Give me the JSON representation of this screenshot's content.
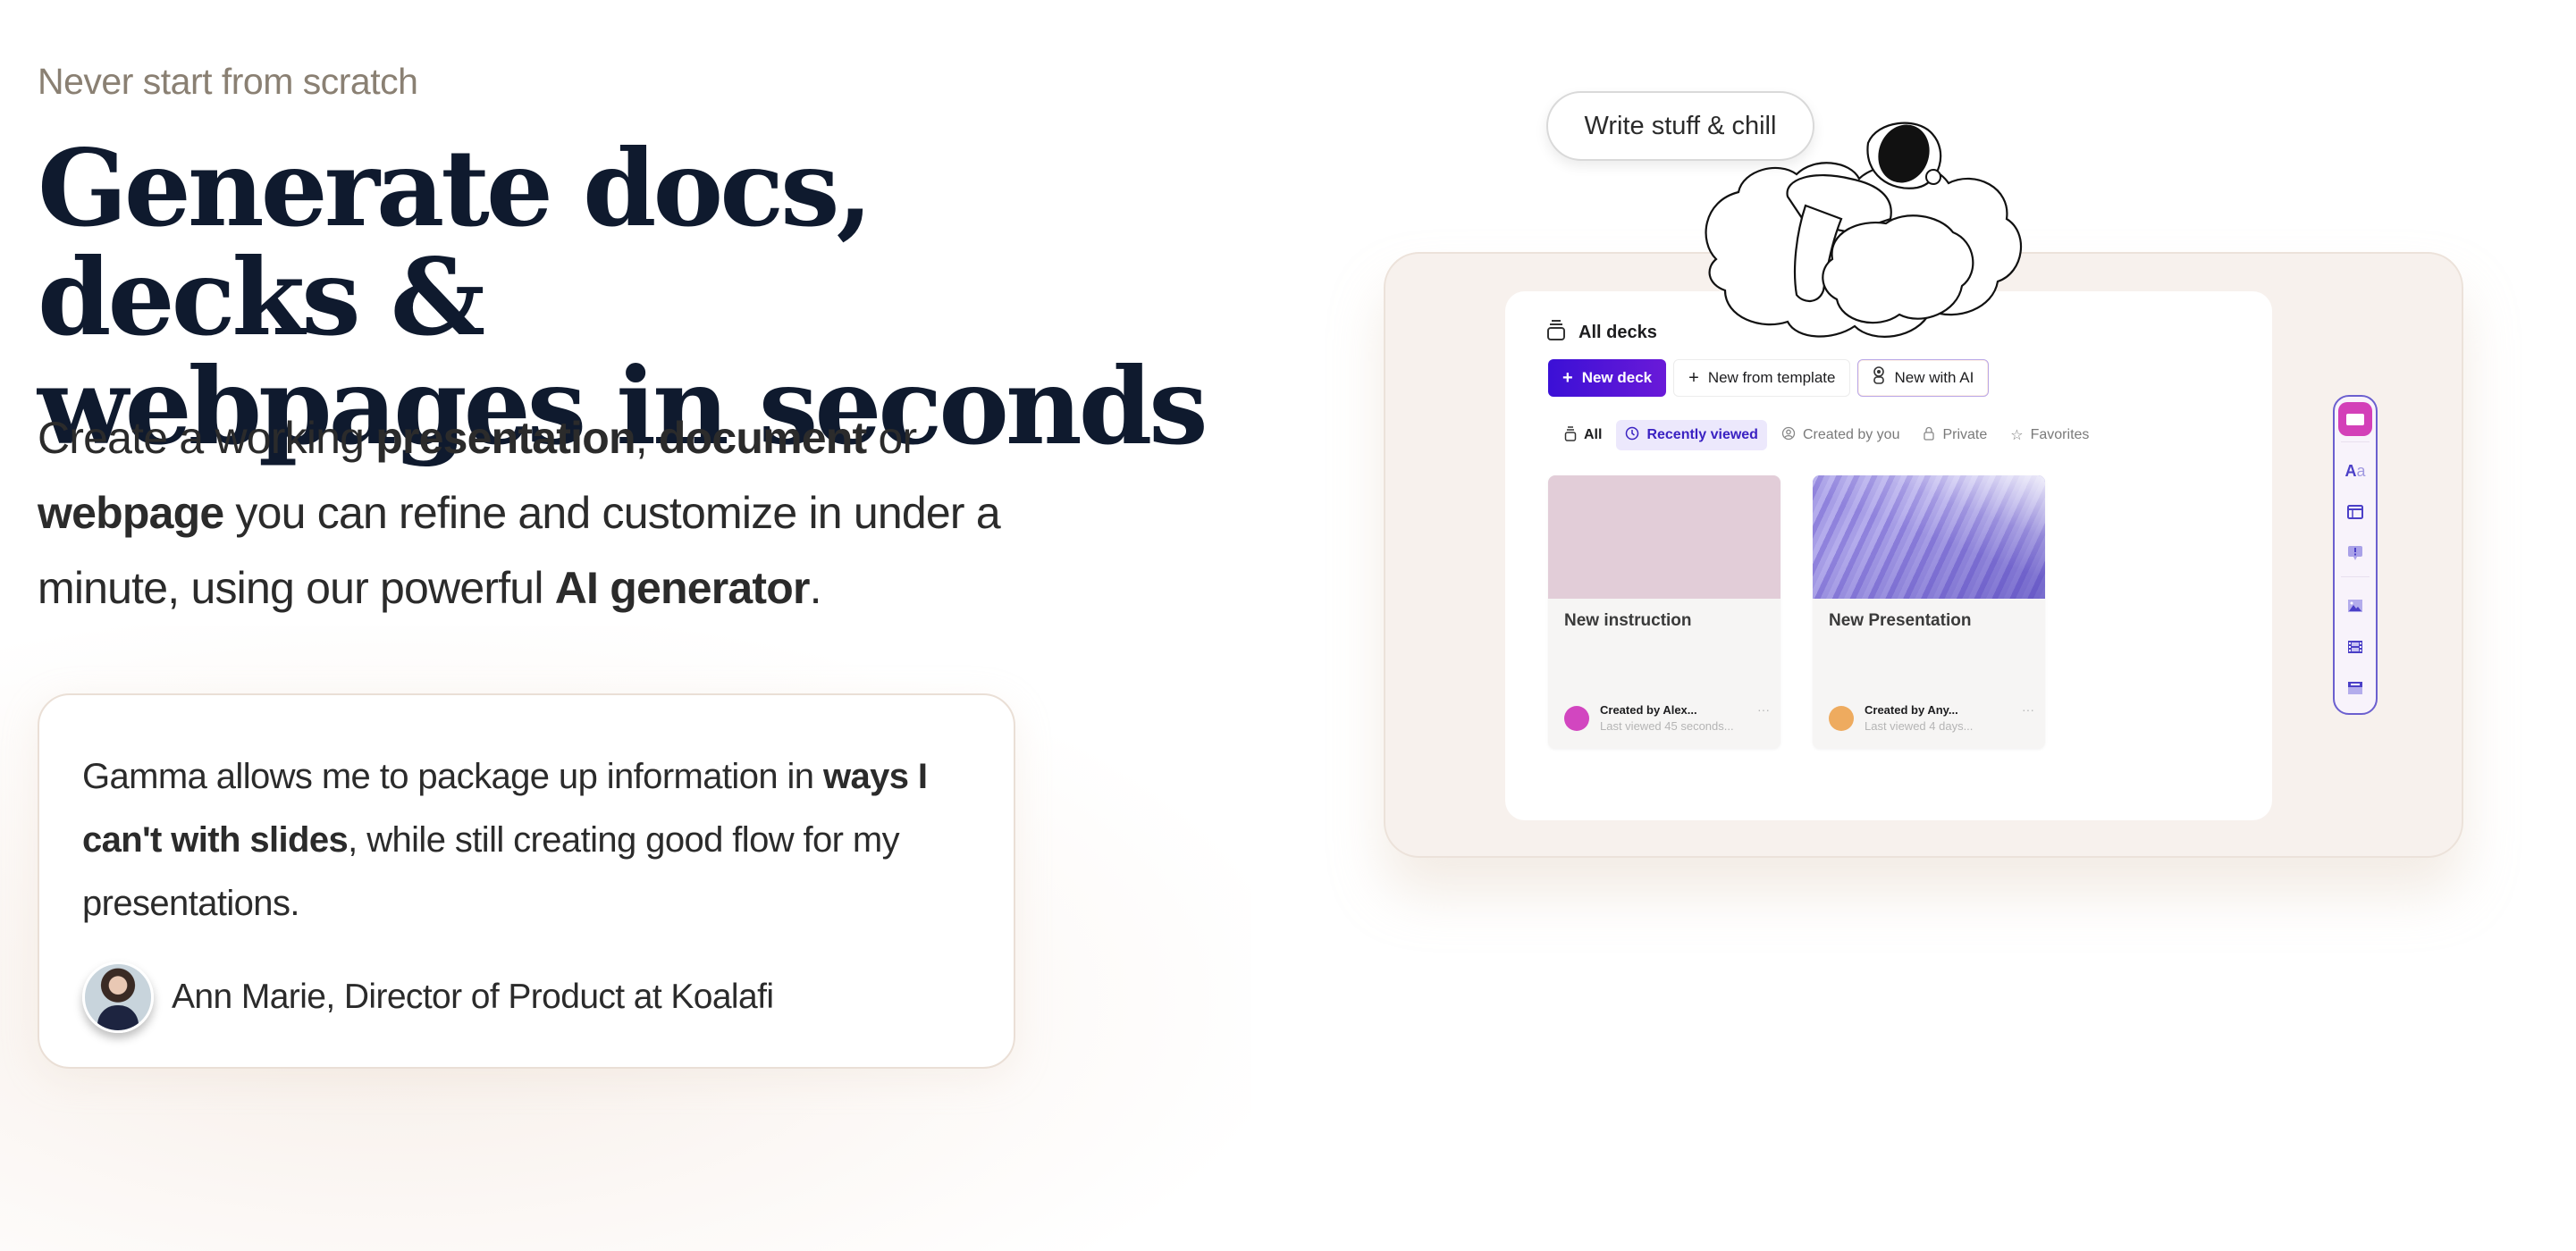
{
  "hero": {
    "eyebrow": "Never start from scratch",
    "headline_line1": "Generate docs, decks &",
    "headline_line2": "webpages in seconds",
    "lead": [
      {
        "text": "Create a working ",
        "bold": false
      },
      {
        "text": "presentation",
        "bold": true
      },
      {
        "text": ", ",
        "bold": false
      },
      {
        "text": "document",
        "bold": true
      },
      {
        "text": " or ",
        "bold": false
      },
      {
        "text": "webpage",
        "bold": true
      },
      {
        "text": " you can refine and customize in under a minute, using our powerful ",
        "bold": false
      },
      {
        "text": "AI generator",
        "bold": true
      },
      {
        "text": ".",
        "bold": false
      }
    ]
  },
  "testimonial": {
    "quote": [
      {
        "text": "Gamma allows me to package up information in ",
        "bold": false
      },
      {
        "text": "ways I can't with slides",
        "bold": true
      },
      {
        "text": ", while still creating good flow for my presentations.",
        "bold": false
      }
    ],
    "author": "Ann Marie, Director of Product at Koalafi",
    "avatar_icon": "person-photo"
  },
  "mockup": {
    "chip_label": "Write stuff & chill",
    "illustration": "astronaut-on-cloud",
    "title": "All decks",
    "title_icon": "stack-icon",
    "actions": [
      {
        "label": "New deck",
        "icon": "plus-icon",
        "style": "primary"
      },
      {
        "label": "New from template",
        "icon": "plus-icon",
        "style": "default"
      },
      {
        "label": "New with AI",
        "icon": "robot-icon",
        "style": "ai"
      }
    ],
    "filters": [
      {
        "label": "All",
        "icon": "stack-icon",
        "active": false
      },
      {
        "label": "Recently viewed",
        "icon": "clock-icon",
        "active": true
      },
      {
        "label": "Created by you",
        "icon": "user-circle-icon",
        "active": false
      },
      {
        "label": "Private",
        "icon": "lock-icon",
        "active": false
      },
      {
        "label": "Favorites",
        "icon": "star-icon",
        "active": false
      }
    ],
    "cards": [
      {
        "title": "New instruction",
        "created_by": "Created by Alex...",
        "last_viewed": "Last viewed 45 seconds...",
        "avatar_color": "#d246c0",
        "thumb_color": "#e2cdd8",
        "more": "···"
      },
      {
        "title": "New Presentation",
        "created_by": "Created by Any...",
        "last_viewed": "Last viewed 4 days...",
        "avatar_color": "#eeab5f",
        "thumb": "purple-mountain-image",
        "more": "···"
      }
    ],
    "tools": [
      "card-icon",
      "text-style-icon",
      "layout-icon",
      "callout-icon",
      "image-icon",
      "video-icon",
      "embed-icon"
    ],
    "colors": {
      "primary": "#3b10d6",
      "active_filter_bg": "#ece8fc",
      "brand_pink": "#d340b8"
    }
  }
}
